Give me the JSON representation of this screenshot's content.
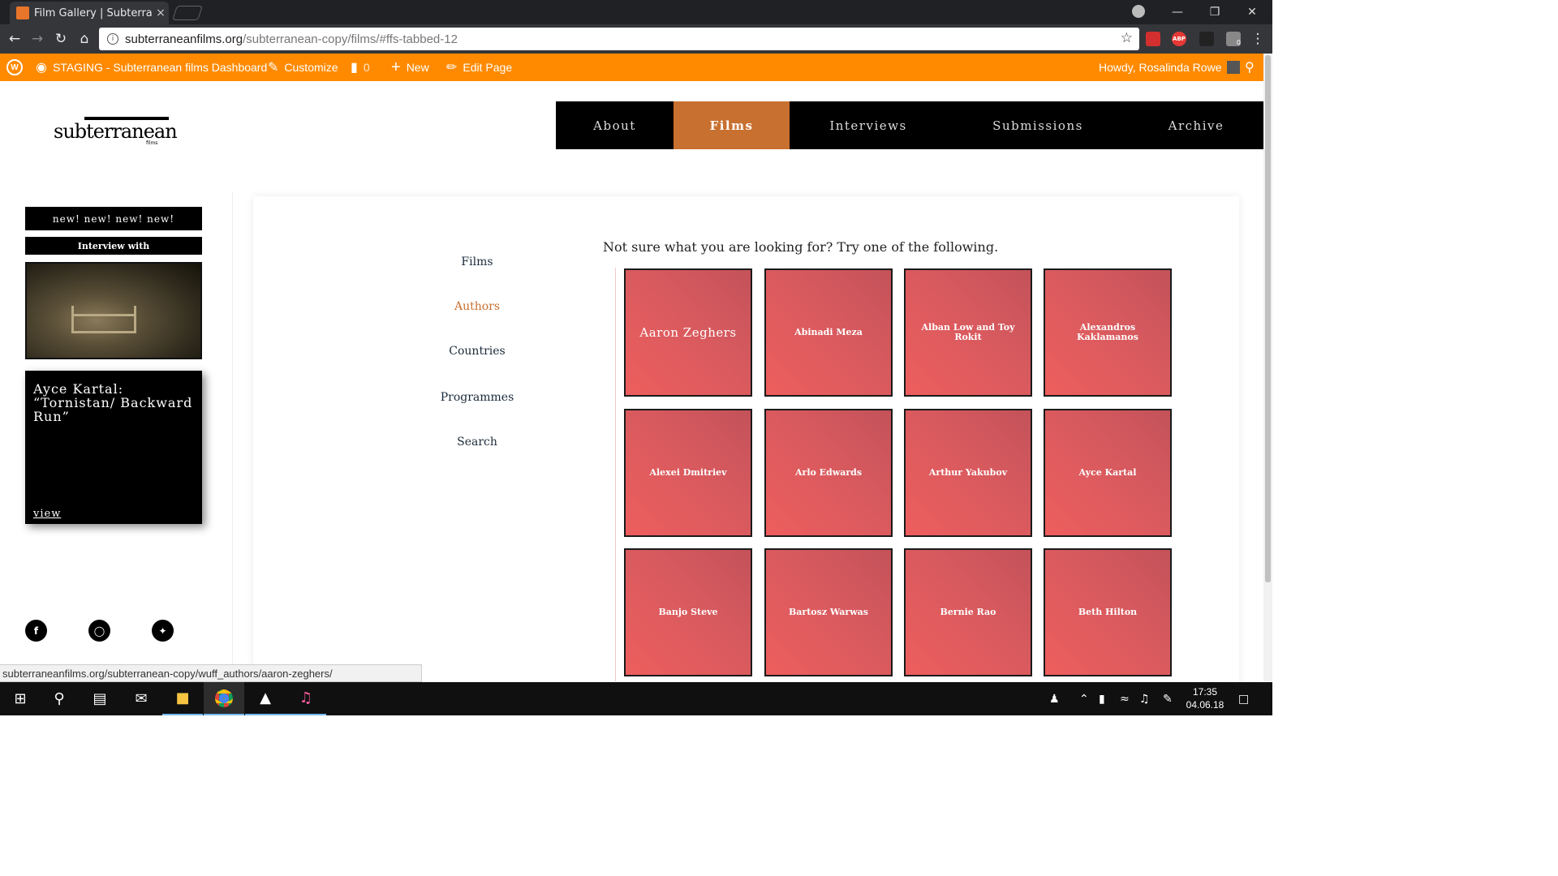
{
  "browser": {
    "tab_title": "Film Gallery | Subterranean films",
    "tab_close": "×",
    "url_domain": "subterraneanfilms.org",
    "url_path": "/subterranean-copy/films/#ffs-tabbed-12",
    "ext_abp": "ABP",
    "ext_badge": "0"
  },
  "wp_bar": {
    "site": "STAGING - Subterranean films Dashboard",
    "customize": "Customize",
    "comments_count": "0",
    "new": "New",
    "edit_page": "Edit Page",
    "howdy": "Howdy, Rosalinda Rowe"
  },
  "site": {
    "logo_sub": "sub",
    "logo_rest": "terranean",
    "logo_small": "films",
    "nav": [
      "About",
      "Films",
      "Interviews",
      "Submissions",
      "Archive"
    ],
    "active_nav": "Films"
  },
  "sidebar": {
    "new_banner": "new! new! new! new!",
    "interview_label": "Interview with",
    "feature_title": "Ayce Kartal: “Tornistan/ Backward Run”",
    "feature_link": "view",
    "social": [
      "facebook-icon",
      "instagram-icon",
      "twitter-icon"
    ]
  },
  "gallery": {
    "categories": [
      "Films",
      "Authors",
      "Countries",
      "Programmes",
      "Search"
    ],
    "active_category": "Authors",
    "hint": "Not sure what you are looking for? Try one of the following.",
    "authors": [
      "Aaron Zeghers",
      "Abinadi Meza",
      "Alban Low and Toy Rokit",
      "Alexandros Kaklamanos",
      "Alexei Dmitriev",
      "Arlo Edwards",
      "Arthur Yakubov",
      "Ayce Kartal",
      "Banjo Steve",
      "Bartosz Warwas",
      "Bernie Rao",
      "Beth Hilton"
    ]
  },
  "status_url": "subterraneanfilms.org/subterranean-copy/wuff_authors/aaron-zeghers/",
  "taskbar": {
    "time": "17:35",
    "date": "04.06.18"
  },
  "colors": {
    "wp_bar": "#ff8a00",
    "nav_active": "#c8702f",
    "tile": "#e05a5e"
  }
}
